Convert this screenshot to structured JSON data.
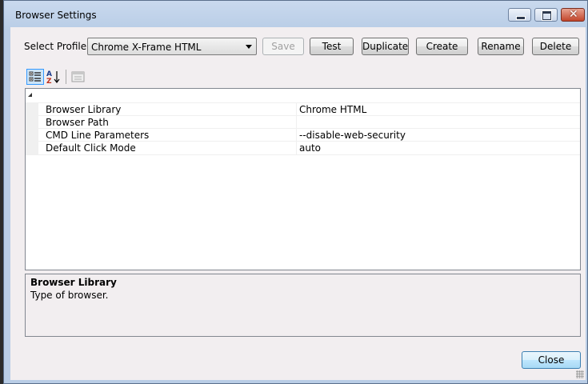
{
  "window": {
    "title": "Browser Settings"
  },
  "profile": {
    "label": "Select Profile:",
    "selected": "Chrome X-Frame HTML"
  },
  "buttons": {
    "save": "Save",
    "test": "Test",
    "duplicate": "Duplicate",
    "create": "Create",
    "rename": "Rename",
    "delete": "Delete",
    "close": "Close"
  },
  "toolbar": {
    "categorized_icon": "categorized-icon",
    "alphabetical_icon": "sort-az-icon",
    "property_pages_icon": "property-pages-icon"
  },
  "properties": [
    {
      "name": "Browser Library",
      "value": "Chrome HTML"
    },
    {
      "name": "Browser Path",
      "value": ""
    },
    {
      "name": "CMD Line Parameters",
      "value": "--disable-web-security"
    },
    {
      "name": "Default Click Mode",
      "value": "auto"
    }
  ],
  "help": {
    "title": "Browser Library",
    "description": "Type of browser."
  },
  "colors": {
    "client_bg": "#f2eef0",
    "close_button_red": "#c2452b",
    "selection_blue": "#3399ff"
  }
}
